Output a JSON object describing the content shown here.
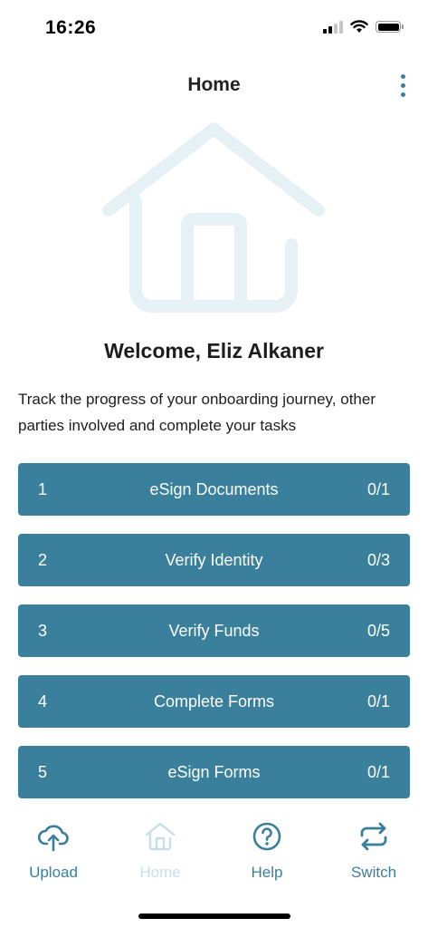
{
  "status_bar": {
    "time": "16:26"
  },
  "header": {
    "title": "Home",
    "menu_icon": "more-vertical-icon"
  },
  "hero": {
    "icon": "house-icon"
  },
  "welcome_text": "Welcome, Eliz Alkaner",
  "intro_text": "Track the progress of your onboarding journey, other parties involved and complete your tasks",
  "tasks": [
    {
      "number": "1",
      "label": "eSign Documents",
      "progress": "0/1"
    },
    {
      "number": "2",
      "label": "Verify Identity",
      "progress": "0/3"
    },
    {
      "number": "3",
      "label": "Verify Funds",
      "progress": "0/5"
    },
    {
      "number": "4",
      "label": "Complete Forms",
      "progress": "0/1"
    },
    {
      "number": "5",
      "label": "eSign Forms",
      "progress": "0/1"
    }
  ],
  "tab_bar": {
    "upload": "Upload",
    "home": "Home",
    "help": "Help",
    "switch": "Switch"
  },
  "colors": {
    "accent": "#3a7f9b",
    "hero_icon": "#e6f1f6",
    "inactive_tab": "#c7dfe8"
  }
}
